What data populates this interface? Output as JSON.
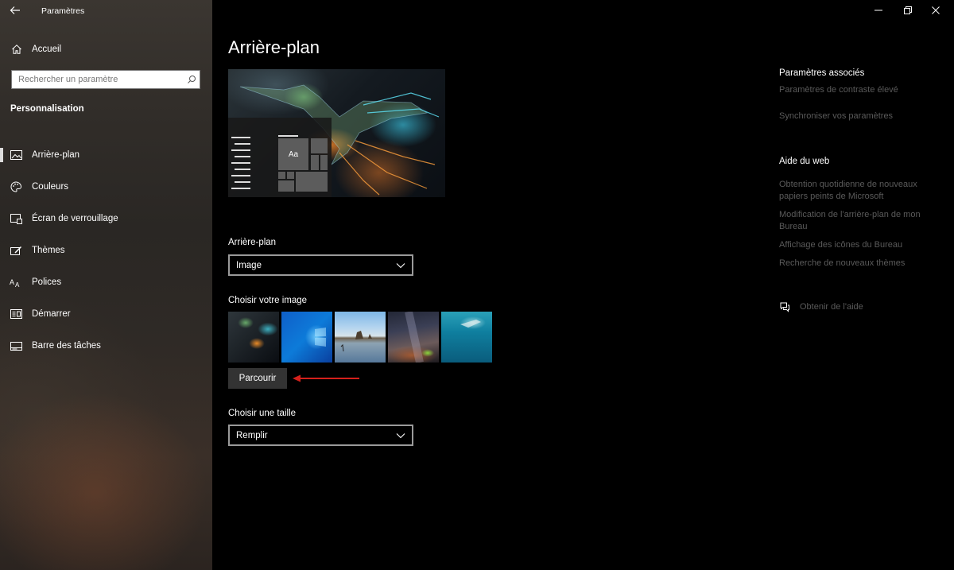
{
  "window": {
    "title": "Paramètres",
    "back_icon": "back-arrow-icon",
    "minimize_glyph": "—",
    "restore_glyph": "❐",
    "close_glyph": "✕"
  },
  "sidebar": {
    "home_label": "Accueil",
    "search_placeholder": "Rechercher un paramètre",
    "section_title": "Personnalisation",
    "items": [
      {
        "label": "Arrière-plan",
        "icon": "picture-icon",
        "active": true
      },
      {
        "label": "Couleurs",
        "icon": "palette-icon",
        "active": false
      },
      {
        "label": "Écran de verrouillage",
        "icon": "lock-screen-icon",
        "active": false
      },
      {
        "label": "Thèmes",
        "icon": "themes-brush-icon",
        "active": false
      },
      {
        "label": "Polices",
        "icon": "fonts-icon",
        "active": false
      },
      {
        "label": "Démarrer",
        "icon": "start-menu-icon",
        "active": false
      },
      {
        "label": "Barre des tâches",
        "icon": "taskbar-icon",
        "active": false
      }
    ]
  },
  "main": {
    "title": "Arrière-plan",
    "preview_tile_text": "Aa",
    "background_label": "Arrière-plan",
    "background_value": "Image",
    "choose_image_label": "Choisir votre image",
    "browse_button": "Parcourir",
    "fit_label": "Choisir une taille",
    "fit_value": "Remplir",
    "annotation_arrow_color": "#d4201b"
  },
  "related": {
    "title": "Paramètres associés",
    "links": [
      "Paramètres de contraste élevé",
      "Synchroniser vos paramètres"
    ]
  },
  "web_help": {
    "title": "Aide du web",
    "links": [
      "Obtention quotidienne de nouveaux papiers peints de Microsoft",
      "Modification de l'arrière-plan de mon Bureau",
      "Affichage des icônes du Bureau",
      "Recherche de nouveaux thèmes"
    ]
  },
  "get_help": "Obtenir de l'aide"
}
